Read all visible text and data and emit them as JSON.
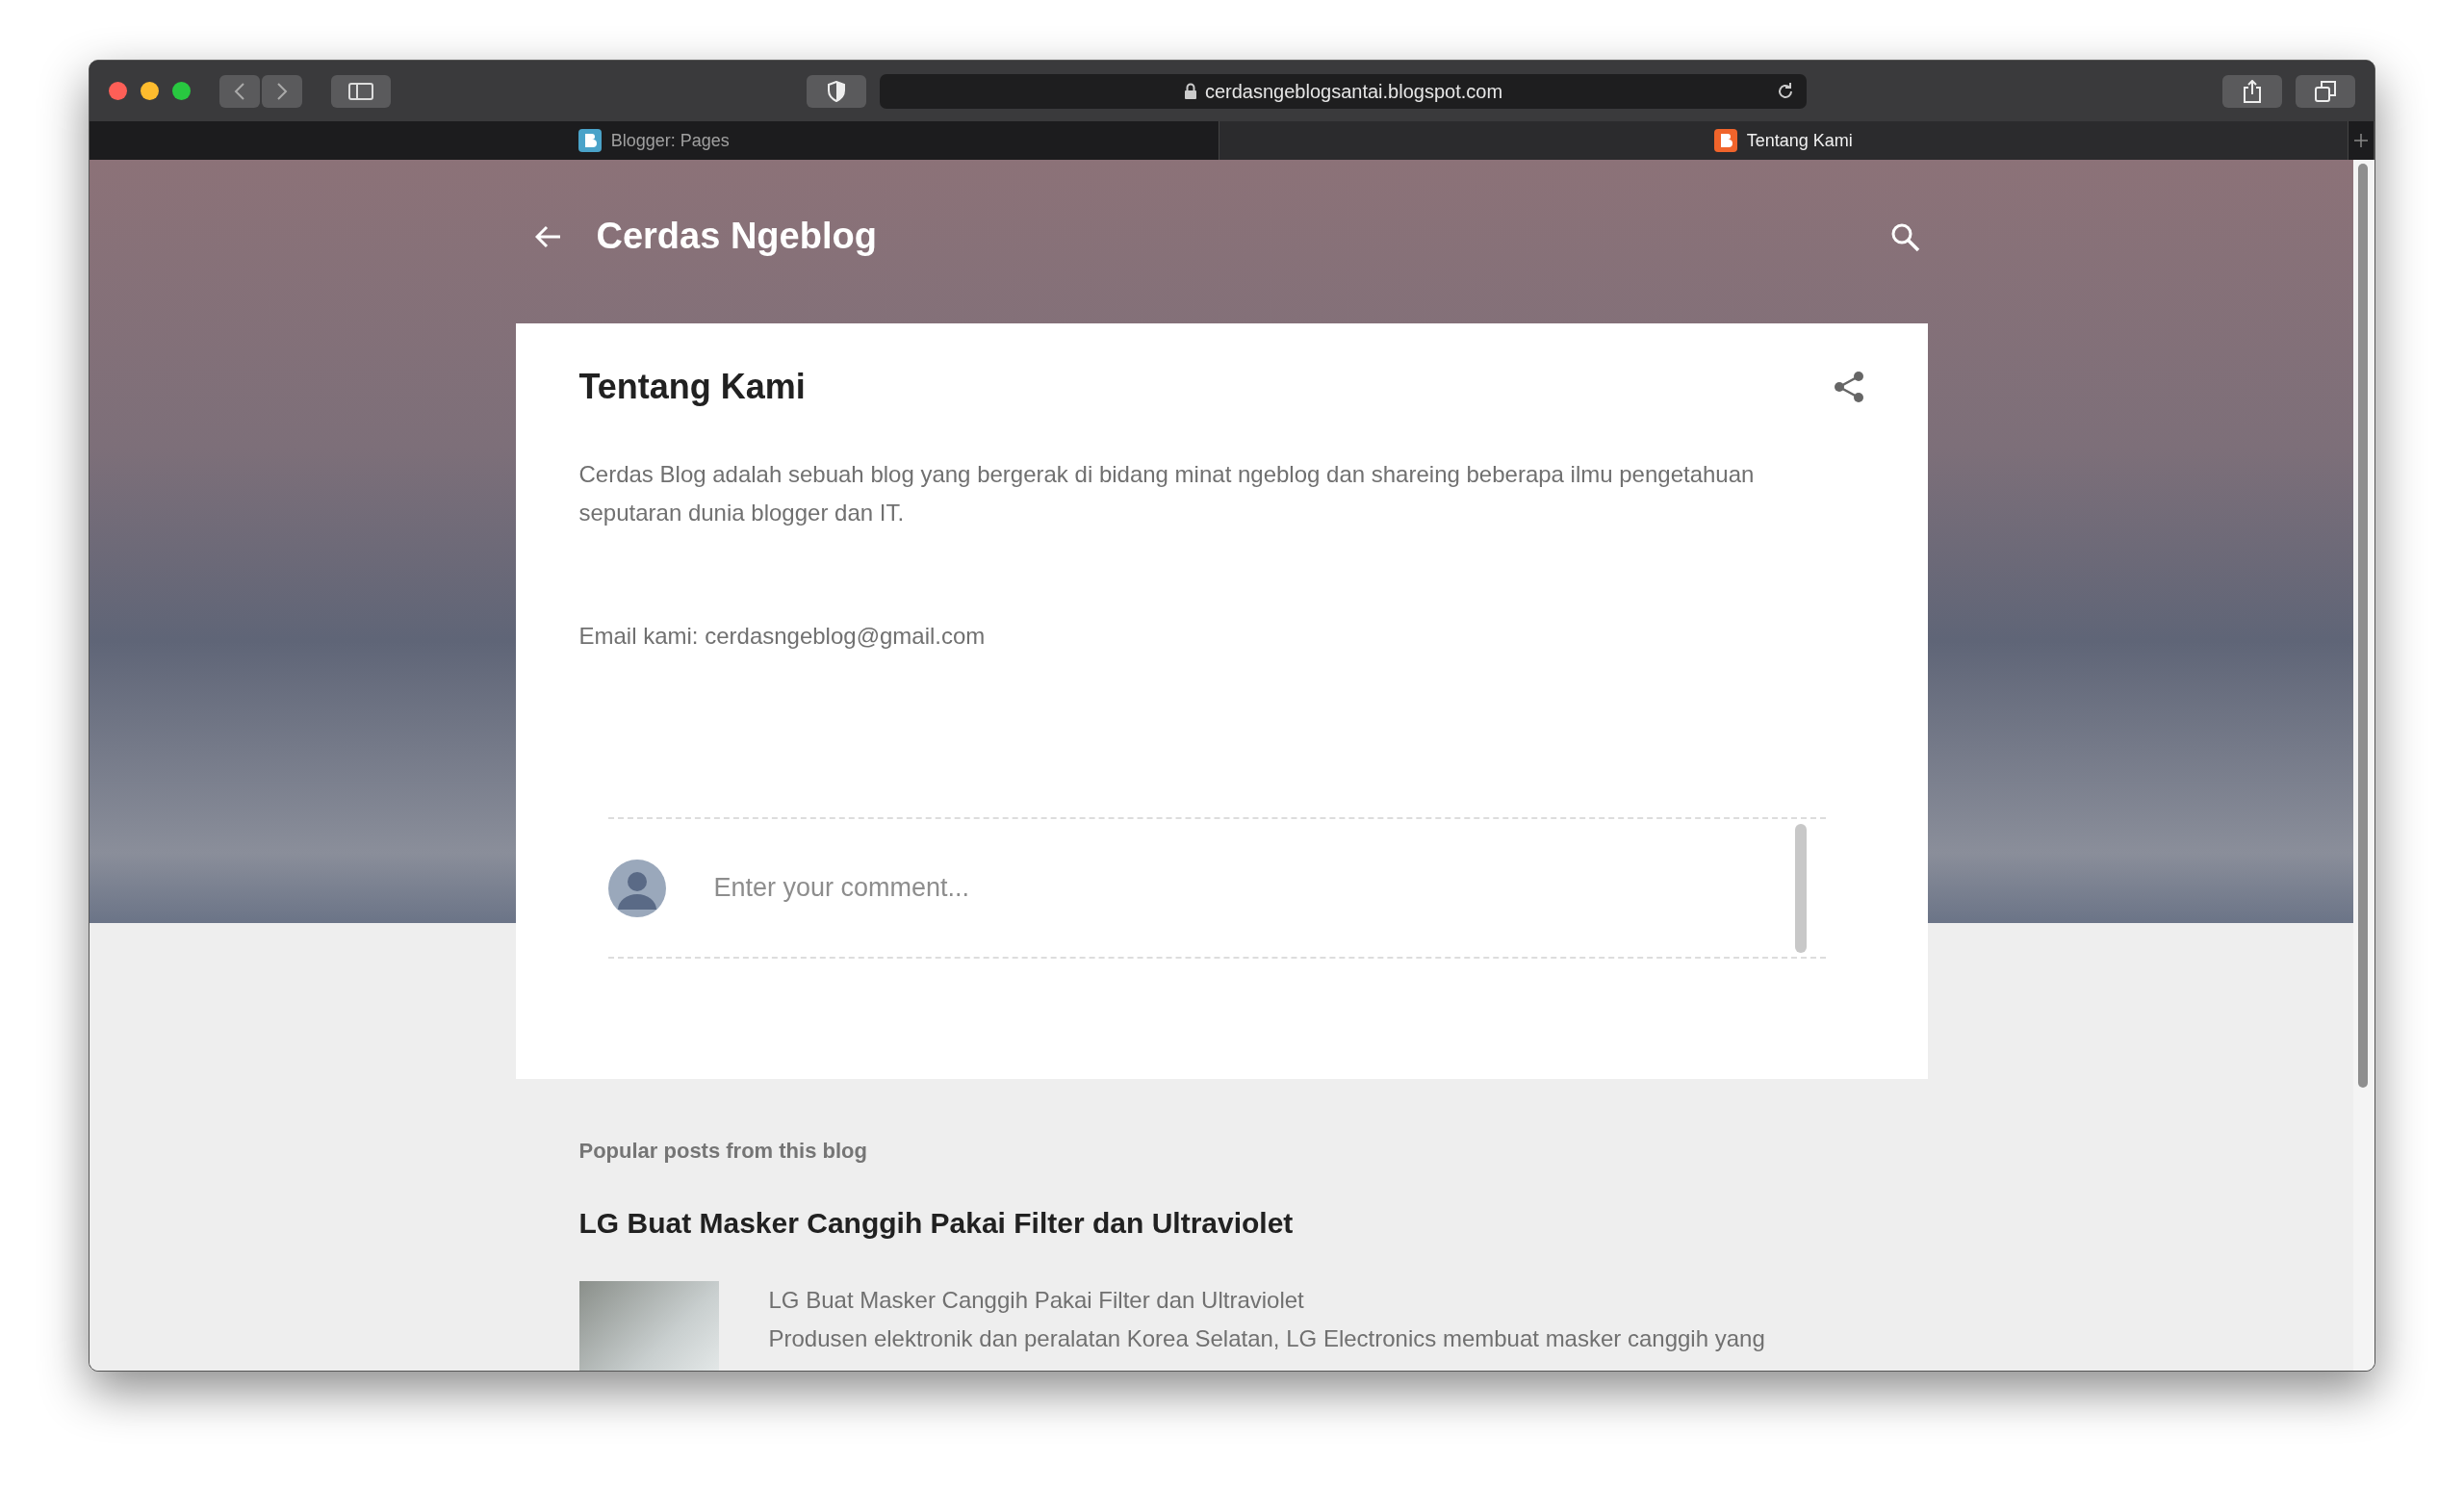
{
  "browser": {
    "url": "cerdasngeblogsantai.blogspot.com",
    "tabs": [
      {
        "label": "Blogger: Pages",
        "selected": false,
        "color": "#4aa3c9"
      },
      {
        "label": "Tentang Kami",
        "selected": true,
        "color": "#f0642b"
      }
    ]
  },
  "blog": {
    "title": "Cerdas Ngeblog"
  },
  "post": {
    "title": "Tentang Kami",
    "paragraphs": [
      "Cerdas Blog adalah sebuah blog yang bergerak di bidang minat ngeblog dan shareing beberapa ilmu pengetahuan seputaran dunia blogger dan IT.",
      "Email kami: cerdasngeblog@gmail.com"
    ]
  },
  "comment": {
    "placeholder": "Enter your comment..."
  },
  "popular": {
    "heading": "Popular posts from this blog",
    "posts": [
      {
        "title": "LG Buat Masker Canggih Pakai Filter dan Ultraviolet",
        "snippet_title": "LG Buat Masker Canggih Pakai Filter dan Ultraviolet",
        "snippet": "Produsen elektronik dan peralatan Korea Selatan, LG Electronics membuat masker canggih yang"
      }
    ]
  }
}
